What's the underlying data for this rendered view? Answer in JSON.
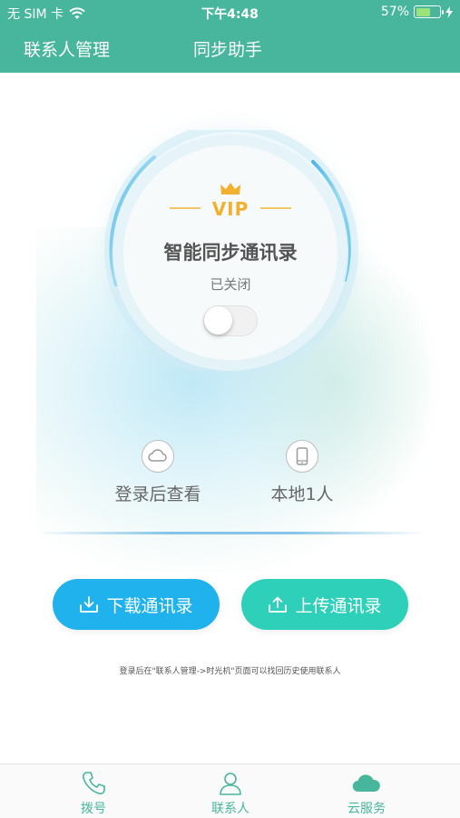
{
  "status_bar": {
    "carrier": "无 SIM 卡",
    "time": "下午4:48",
    "battery": "57%"
  },
  "nav": {
    "tabs": [
      "联系人管理",
      "同步助手"
    ]
  },
  "sync_card": {
    "badge": "VIP",
    "title": "智能同步通讯录",
    "status": "已关闭",
    "toggle_on": false
  },
  "info": {
    "cloud_label": "登录后查看",
    "local_label": "本地1人"
  },
  "actions": {
    "download": "下载通讯录",
    "upload": "上传通讯录"
  },
  "hint": "登录后在\"联系人管理->时光机\"页面可以找回历史使用联系人",
  "tabbar": {
    "items": [
      {
        "label": "拨号",
        "icon": "phone-icon"
      },
      {
        "label": "联系人",
        "icon": "person-icon"
      },
      {
        "label": "云服务",
        "icon": "cloud-icon"
      }
    ]
  },
  "colors": {
    "brand": "#48b69d",
    "download": "#1fb2ec",
    "upload": "#2ed0b9",
    "vip": "#f1b12f"
  }
}
